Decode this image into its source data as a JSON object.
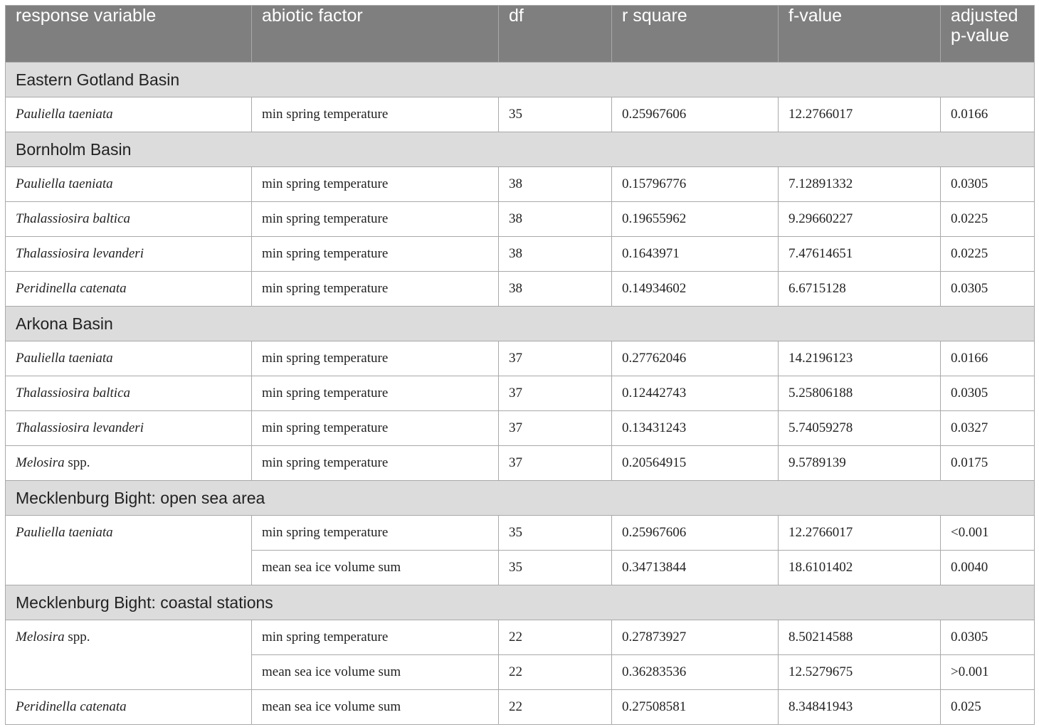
{
  "table": {
    "headers": [
      "response variable",
      "abiotic factor",
      "df",
      "r square",
      "f-value",
      "adjusted p-value"
    ],
    "header_lines_last": [
      "adjusted",
      "p-value"
    ],
    "sections": [
      {
        "title": "Eastern Gotland Basin",
        "groups": [
          {
            "species": "Pauliella taeniata",
            "species_suffix": "",
            "rows": [
              {
                "factor": "min spring temperature",
                "df": "35",
                "r2": "0.25967606",
                "f": "12.2766017",
                "p": "0.0166"
              }
            ]
          }
        ]
      },
      {
        "title": "Bornholm Basin",
        "groups": [
          {
            "species": "Pauliella taeniata",
            "species_suffix": "",
            "rows": [
              {
                "factor": "min spring temperature",
                "df": "38",
                "r2": "0.15796776",
                "f": "7.12891332",
                "p": "0.0305"
              }
            ]
          },
          {
            "species": "Thalassiosira baltica",
            "species_suffix": "",
            "rows": [
              {
                "factor": "min spring temperature",
                "df": "38",
                "r2": "0.19655962",
                "f": "9.29660227",
                "p": "0.0225"
              }
            ]
          },
          {
            "species": "Thalassiosira levanderi",
            "species_suffix": "",
            "rows": [
              {
                "factor": "min spring temperature",
                "df": "38",
                "r2": "0.1643971",
                "f": "7.47614651",
                "p": "0.0225"
              }
            ]
          },
          {
            "species": "Peridinella catenata",
            "species_suffix": "",
            "rows": [
              {
                "factor": "min spring temperature",
                "df": "38",
                "r2": "0.14934602",
                "f": "6.6715128",
                "p": "0.0305"
              }
            ]
          }
        ]
      },
      {
        "title": "Arkona Basin",
        "groups": [
          {
            "species": "Pauliella taeniata",
            "species_suffix": "",
            "rows": [
              {
                "factor": "min spring temperature",
                "df": "37",
                "r2": "0.27762046",
                "f": "14.2196123",
                "p": "0.0166"
              }
            ]
          },
          {
            "species": "Thalassiosira baltica",
            "species_suffix": "",
            "rows": [
              {
                "factor": "min spring temperature",
                "df": "37",
                "r2": "0.12442743",
                "f": "5.25806188",
                "p": "0.0305"
              }
            ]
          },
          {
            "species": "Thalassiosira levanderi",
            "species_suffix": "",
            "rows": [
              {
                "factor": "min spring temperature",
                "df": "37",
                "r2": "0.13431243",
                "f": "5.74059278",
                "p": "0.0327"
              }
            ]
          },
          {
            "species": "Melosira",
            "species_suffix": " spp.",
            "rows": [
              {
                "factor": "min spring temperature",
                "df": "37",
                "r2": "0.20564915",
                "f": "9.5789139",
                "p": "0.0175"
              }
            ]
          }
        ]
      },
      {
        "title": "Mecklenburg Bight: open sea area",
        "groups": [
          {
            "species": "Pauliella taeniata",
            "species_suffix": "",
            "rows": [
              {
                "factor": "min spring temperature",
                "df": "35",
                "r2": "0.25967606",
                "f": "12.2766017",
                "p": "<0.001"
              },
              {
                "factor": "mean sea ice volume sum",
                "df": "35",
                "r2": "0.34713844",
                "f": "18.6101402",
                "p": "0.0040"
              }
            ]
          }
        ]
      },
      {
        "title": "Mecklenburg Bight: coastal stations",
        "groups": [
          {
            "species": "Melosira",
            "species_suffix": " spp.",
            "rows": [
              {
                "factor": "min spring temperature",
                "df": "22",
                "r2": "0.27873927",
                "f": "8.50214588",
                "p": "0.0305"
              },
              {
                "factor": "mean sea ice volume sum",
                "df": "22",
                "r2": "0.36283536",
                "f": "12.5279675",
                "p": ">0.001"
              }
            ]
          },
          {
            "species": "Peridinella catenata",
            "species_suffix": "",
            "rows": [
              {
                "factor": "mean sea ice volume sum",
                "df": "22",
                "r2": "0.27508581",
                "f": "8.34841943",
                "p": "0.025"
              }
            ]
          }
        ]
      }
    ]
  }
}
